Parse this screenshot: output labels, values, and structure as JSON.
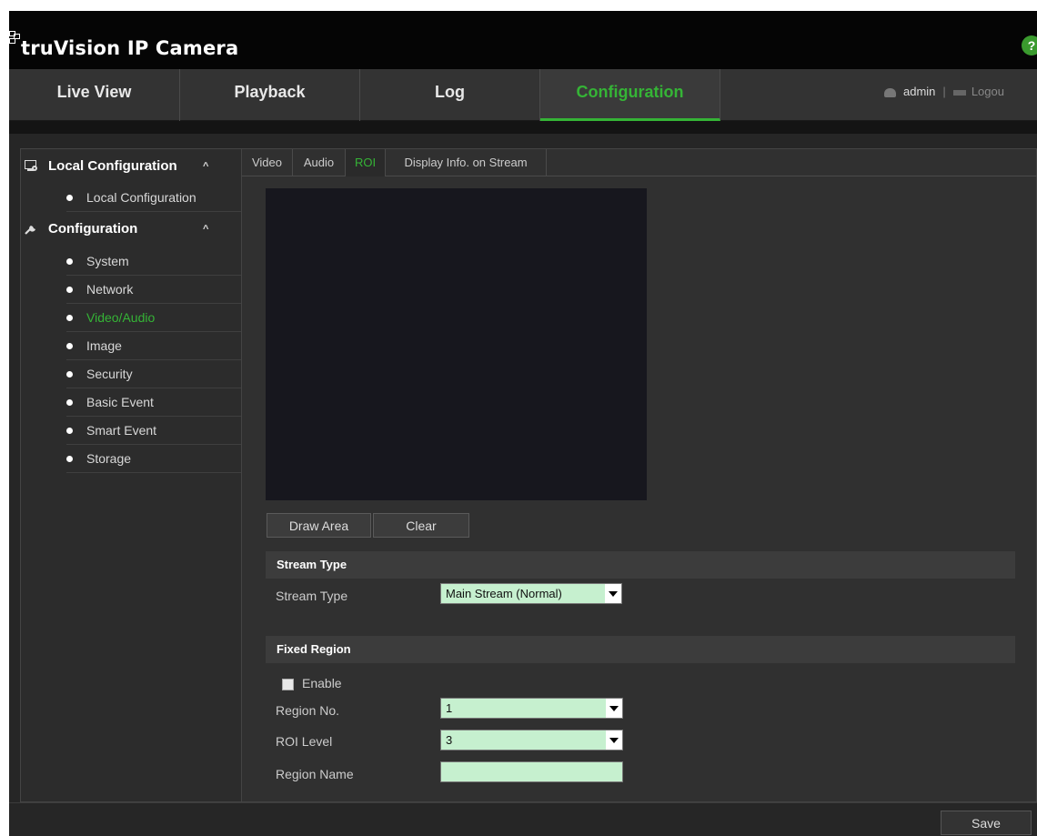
{
  "app": {
    "title": "truVision IP Camera"
  },
  "help": {
    "label": "?"
  },
  "nav": {
    "tabs": [
      {
        "label": "Live View"
      },
      {
        "label": "Playback"
      },
      {
        "label": "Log"
      },
      {
        "label": "Configuration"
      }
    ],
    "active_tab": "Configuration",
    "user": {
      "name": "admin",
      "separator": "|",
      "logout": "Logou"
    }
  },
  "sidebar": {
    "sections": [
      {
        "label": "Local Configuration",
        "icon": "computer-settings-icon",
        "caret": "^",
        "items": [
          {
            "label": "Local Configuration"
          }
        ]
      },
      {
        "label": "Configuration",
        "icon": "wrench-icon",
        "caret": "^",
        "items": [
          {
            "label": "System"
          },
          {
            "label": "Network"
          },
          {
            "label": "Video/Audio"
          },
          {
            "label": "Image"
          },
          {
            "label": "Security"
          },
          {
            "label": "Basic Event"
          },
          {
            "label": "Smart Event"
          },
          {
            "label": "Storage"
          }
        ]
      }
    ],
    "active_item": "Video/Audio"
  },
  "subtabs": [
    {
      "label": "Video"
    },
    {
      "label": "Audio"
    },
    {
      "label": "ROI"
    },
    {
      "label": "Display Info. on Stream"
    }
  ],
  "active_subtab": "ROI",
  "roi": {
    "draw_area_label": "Draw Area",
    "clear_label": "Clear",
    "stream_section": "Stream Type",
    "stream_type_label": "Stream Type",
    "stream_type_value": "Main Stream (Normal)",
    "fixed_region_section": "Fixed Region",
    "enable_label": "Enable",
    "enable_checked": false,
    "region_no_label": "Region No.",
    "region_no_value": "1",
    "roi_level_label": "ROI Level",
    "roi_level_value": "3",
    "region_name_label": "Region Name",
    "region_name_value": ""
  },
  "footer": {
    "save_label": "Save"
  },
  "colors": {
    "accent": "#35b436",
    "background": "#262626",
    "field": "#c6f0cf"
  }
}
